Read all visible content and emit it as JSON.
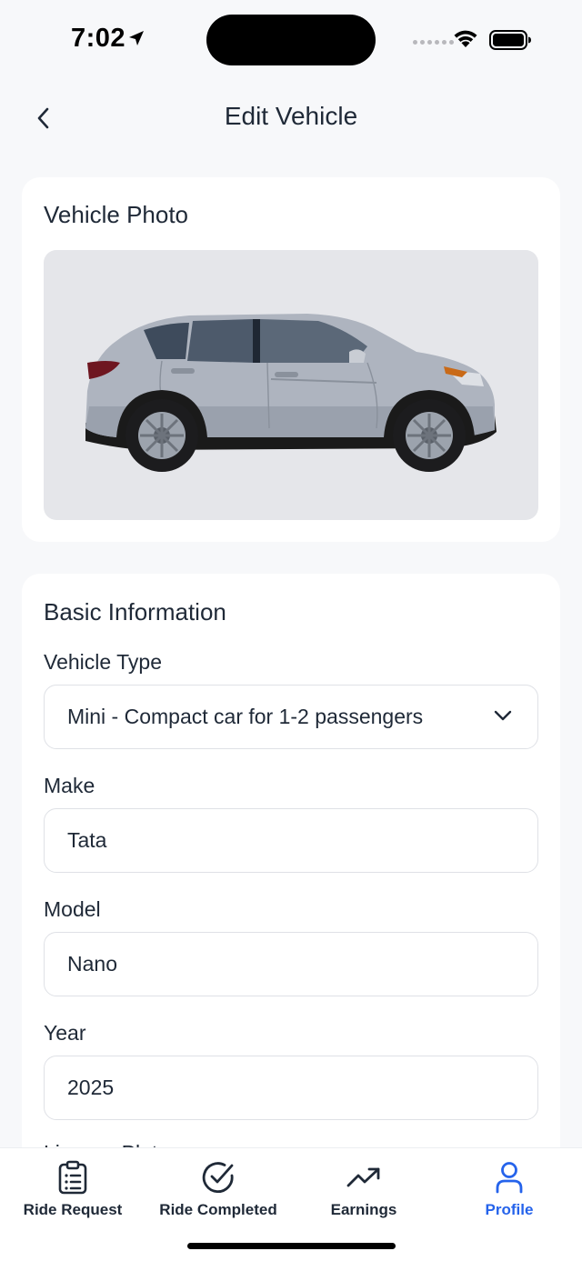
{
  "status_bar": {
    "time": "7:02"
  },
  "header": {
    "title": "Edit Vehicle"
  },
  "photo_card": {
    "title": "Vehicle Photo"
  },
  "basic_info": {
    "title": "Basic Information",
    "vehicle_type": {
      "label": "Vehicle Type",
      "value": "Mini - Compact car for 1-2 passengers"
    },
    "make": {
      "label": "Make",
      "value": "Tata"
    },
    "model": {
      "label": "Model",
      "value": "Nano"
    },
    "year": {
      "label": "Year",
      "value": "2025"
    },
    "license_plate": {
      "label": "License Plate"
    }
  },
  "tabs": [
    {
      "label": "Ride Request",
      "icon": "clipboard-list-icon",
      "active": false
    },
    {
      "label": "Ride Completed",
      "icon": "check-circle-icon",
      "active": false
    },
    {
      "label": "Earnings",
      "icon": "trending-up-icon",
      "active": false
    },
    {
      "label": "Profile",
      "icon": "user-icon",
      "active": true
    }
  ],
  "colors": {
    "accent": "#2563eb",
    "background": "#f7f8fa",
    "card": "#ffffff",
    "photo_bg": "#e5e6ea",
    "car_body": "#aeb4bf"
  }
}
